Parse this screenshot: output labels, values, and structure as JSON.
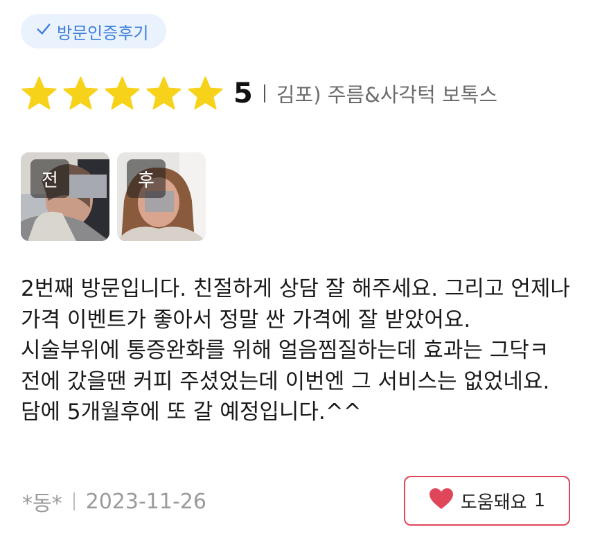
{
  "badge": {
    "icon": "checkmark-icon",
    "label": "방문인증후기",
    "color": "#3b7ddd"
  },
  "rating": {
    "stars": 5,
    "max_stars": 5,
    "star_color": "#f7d21b",
    "score": "5",
    "treatment": "김포) 주름&사각턱 보톡스"
  },
  "photos": [
    {
      "label": "전"
    },
    {
      "label": "후"
    }
  ],
  "review": {
    "text": "2번째 방문입니다. 친절하게 상담 잘 해주세요. 그리고 언제나 가격 이벤트가 좋아서 정말 싼 가격에 잘 받았어요. 시술부위에 통증완화를 위해 얼음찜질하는데 효과는 그닥ㅋ 전에 갔을땐 커피 주셨었는데 이번엔 그 서비스는 없었네요. 담에 5개월후에 또 갈 예정입니다.^^"
  },
  "meta": {
    "author": "*동*",
    "date": "2023-11-26"
  },
  "helpful": {
    "icon": "heart-icon",
    "label": "도움돼요",
    "count": "1",
    "color": "#e0465a"
  }
}
